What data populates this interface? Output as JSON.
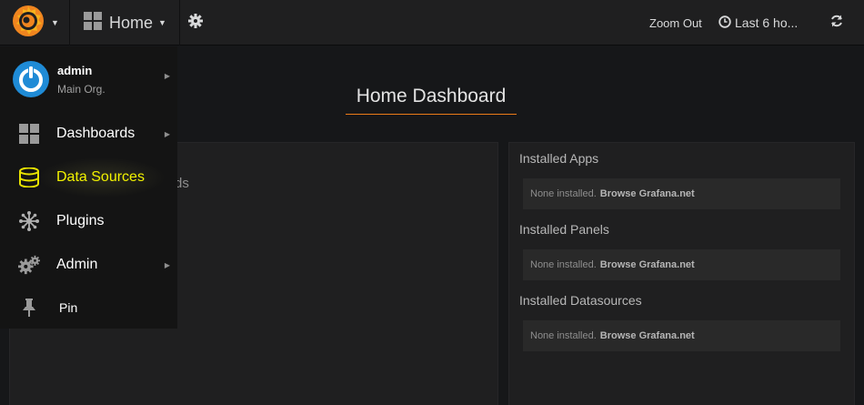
{
  "navbar": {
    "dashboard_name": "Home",
    "zoom_out_label": "Zoom Out",
    "time_range_label": "Last 6 ho...",
    "icons": [
      "grafana-logo-icon",
      "dashboard-grid-icon",
      "gear-icon",
      "clock-icon",
      "refresh-icon"
    ]
  },
  "sidemenu": {
    "user": {
      "name": "admin",
      "org": "Main Org."
    },
    "items": [
      {
        "label": "Dashboards",
        "icon": "dashboards-icon",
        "has_submenu": true
      },
      {
        "label": "Data Sources",
        "icon": "database-icon",
        "active": true
      },
      {
        "label": "Plugins",
        "icon": "plugins-icon"
      },
      {
        "label": "Admin",
        "icon": "admin-gears-icon",
        "has_submenu": true
      },
      {
        "label": "Pin",
        "icon": "pin-icon"
      }
    ]
  },
  "dashboard": {
    "title": "Home Dashboard",
    "left_panel_partial_text": "ds",
    "sections": [
      {
        "title": "Installed Apps",
        "none_text": "None installed.",
        "link_text": "Browse Grafana.net"
      },
      {
        "title": "Installed Panels",
        "none_text": "None installed.",
        "link_text": "Browse Grafana.net"
      },
      {
        "title": "Installed Datasources",
        "none_text": "None installed.",
        "link_text": "Browse Grafana.net"
      }
    ]
  },
  "colors": {
    "background": "#161719",
    "panel": "#1f1f20",
    "sidemenu": "#141414",
    "active_item": "#f2f200",
    "accent_underline": "#eb7b18",
    "logo_orange": "#f0851f",
    "avatar_blue": "#1f8bd6"
  }
}
